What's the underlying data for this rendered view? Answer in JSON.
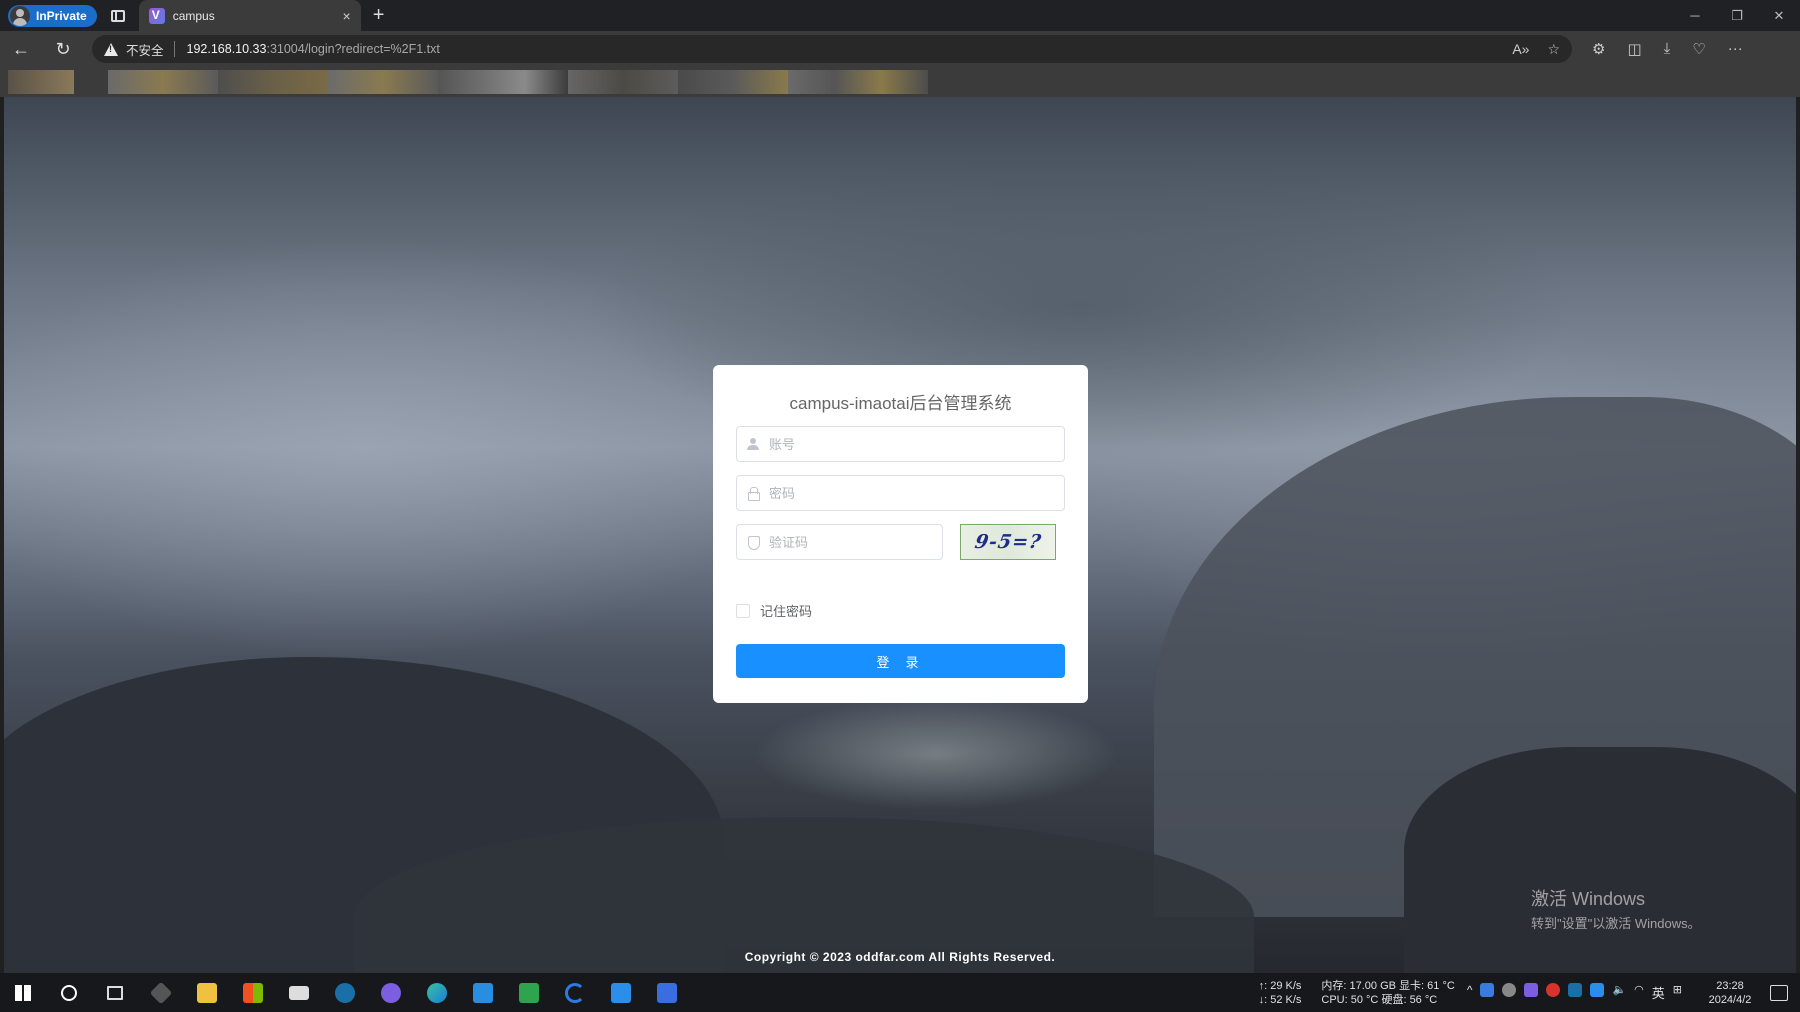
{
  "browser": {
    "inprivate_label": "InPrivate",
    "tab_title": "campus",
    "tab_close": "×",
    "new_tab": "+",
    "security_label": "不安全",
    "url_host": "192.168.10.33",
    "url_path": ":31004/login?redirect=%2F1.txt"
  },
  "login": {
    "title": "campus-imaotai后台管理系统",
    "username_placeholder": "账号",
    "password_placeholder": "密码",
    "captcha_placeholder": "验证码",
    "captcha_text": "9-5=?",
    "remember_label": "记住密码",
    "login_button": "登 录"
  },
  "footer": {
    "copyright": "Copyright © 2023 oddfar.com All Rights Reserved."
  },
  "watermark": {
    "line1": "激活 Windows",
    "line2": "转到\"设置\"以激活 Windows。"
  },
  "taskbar": {
    "net_up": "↑: 29 K/s",
    "net_down": "↓: 52 K/s",
    "mem": "内存: 17.00 GB",
    "gpu": "显卡: 61 °C",
    "cpu": "CPU: 50 °C",
    "disk": "硬盘: 56 °C",
    "ime": "英",
    "time": "23:28",
    "date": "2024/4/2"
  },
  "colors": {
    "primary_button": "#1890ff",
    "tab_active": "#3b3b3b",
    "inprivate_badge": "#1a6dc9"
  }
}
